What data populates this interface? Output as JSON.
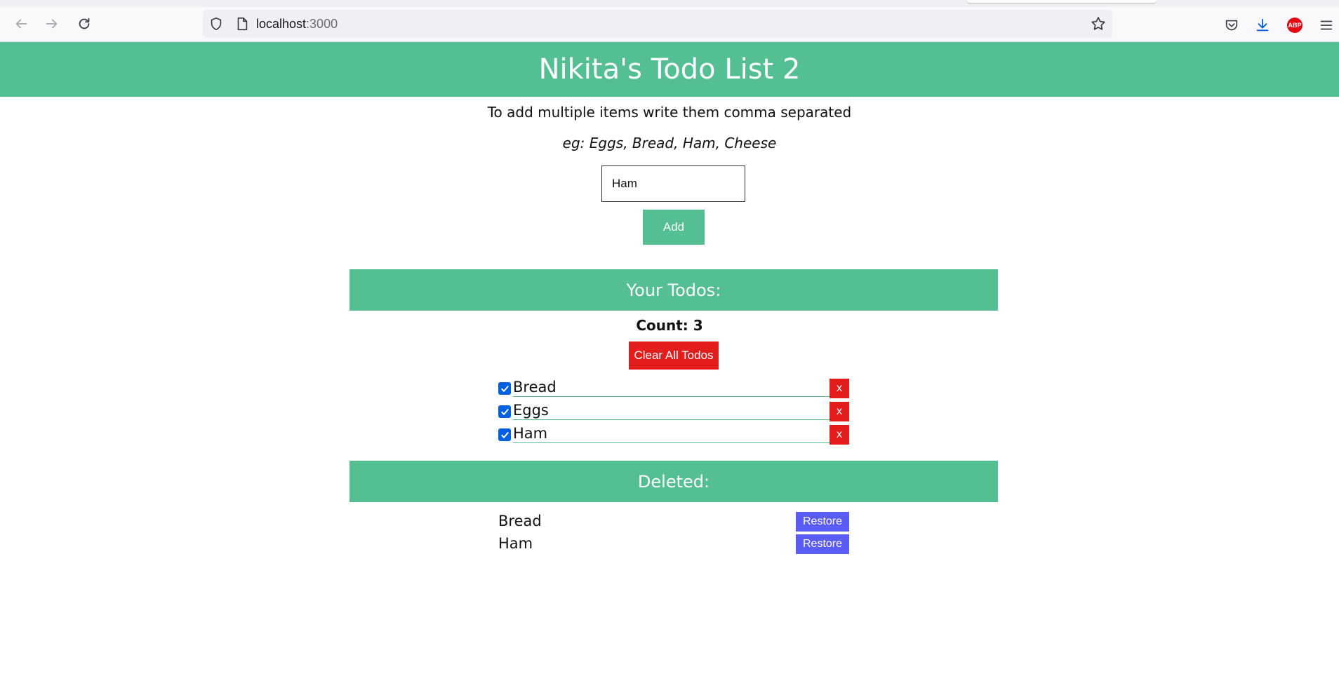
{
  "browser": {
    "url_host": "localhost",
    "url_port": ":3000",
    "icons": {
      "back": "back-arrow-icon",
      "forward": "forward-arrow-icon",
      "reload": "reload-icon",
      "shield": "shield-icon",
      "page": "page-icon",
      "bookmark": "star-icon",
      "pocket": "pocket-icon",
      "download": "download-icon",
      "adblock": "adblock-icon",
      "menu": "hamburger-menu-icon"
    },
    "adblock_label": "ABP"
  },
  "app": {
    "title": "Nikita's Todo List 2",
    "hint_line1": "To add multiple items write them comma separated",
    "hint_line2": "eg: Eggs, Bread, Ham, Cheese",
    "input_value": "Ham",
    "add_label": "Add",
    "todos_heading": "Your Todos:",
    "count_label": "Count:",
    "count_value": "3",
    "clear_label": "Clear All Todos",
    "todos": [
      {
        "text": "Bread",
        "checked": true,
        "delete_label": "x"
      },
      {
        "text": "Eggs",
        "checked": true,
        "delete_label": "x"
      },
      {
        "text": "Ham",
        "checked": true,
        "delete_label": "x"
      }
    ],
    "deleted_heading": "Deleted:",
    "deleted": [
      {
        "text": "Bread",
        "restore_label": "Restore"
      },
      {
        "text": "Ham",
        "restore_label": "Restore"
      }
    ]
  },
  "colors": {
    "accent_green": "#54bf93",
    "danger_red": "#e31c1c",
    "restore_blue": "#5b5bf5",
    "checkbox_blue": "#0060df"
  }
}
